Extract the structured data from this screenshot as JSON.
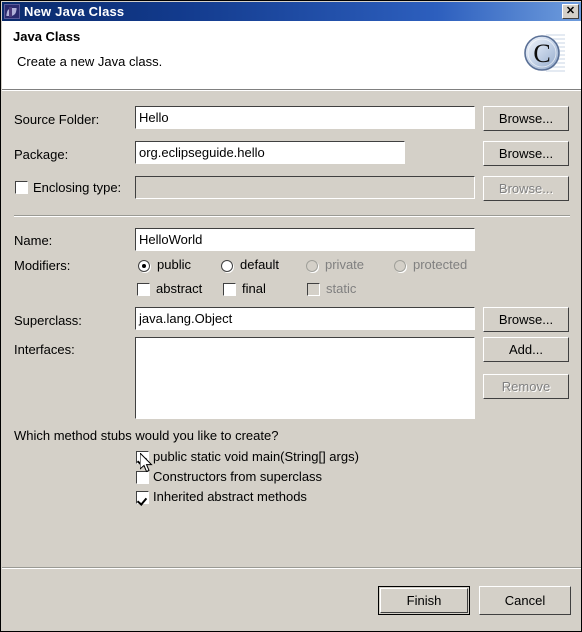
{
  "window": {
    "title": "New Java Class",
    "icon": "eclipse-java-icon",
    "close_label": "✕"
  },
  "header": {
    "title": "Java Class",
    "description": "Create a new Java class.",
    "badge_letter": "C",
    "badge_name": "class-badge-icon"
  },
  "fields": {
    "source_folder": {
      "label": "Source Folder:",
      "value": "Hello",
      "button": "Browse...",
      "button_enabled": true
    },
    "package": {
      "label": "Package:",
      "value": "org.eclipseguide.hello",
      "button": "Browse...",
      "button_enabled": true
    },
    "enclosing_type": {
      "label": "Enclosing type:",
      "value": "",
      "checked": false,
      "enabled": false,
      "button": "Browse...",
      "button_enabled": false
    },
    "name": {
      "label": "Name:",
      "value": "HelloWorld"
    },
    "superclass": {
      "label": "Superclass:",
      "value": "java.lang.Object",
      "button": "Browse...",
      "button_enabled": true
    },
    "interfaces": {
      "label": "Interfaces:",
      "items": [],
      "add_button": "Add...",
      "add_enabled": true,
      "remove_button": "Remove",
      "remove_enabled": false
    }
  },
  "modifiers": {
    "label": "Modifiers:",
    "access": [
      {
        "label": "public",
        "checked": true,
        "enabled": true
      },
      {
        "label": "default",
        "checked": false,
        "enabled": true
      },
      {
        "label": "private",
        "checked": false,
        "enabled": false
      },
      {
        "label": "protected",
        "checked": false,
        "enabled": false
      }
    ],
    "flags": [
      {
        "label": "abstract",
        "checked": false,
        "enabled": true
      },
      {
        "label": "final",
        "checked": false,
        "enabled": true
      },
      {
        "label": "static",
        "checked": false,
        "enabled": false
      }
    ]
  },
  "method_stubs": {
    "question": "Which method stubs would you like to create?",
    "options": [
      {
        "label": "public static void main(String[] args)",
        "checked": true
      },
      {
        "label": "Constructors from superclass",
        "checked": false
      },
      {
        "label": "Inherited abstract methods",
        "checked": true
      }
    ]
  },
  "footer": {
    "finish": "Finish",
    "cancel": "Cancel"
  },
  "colors": {
    "dialog_face": "#d4d0c8",
    "titlebar_start": "#0a2a6b",
    "titlebar_end": "#6f9ddd",
    "field_bg": "#ffffff",
    "disabled_text": "#808080"
  }
}
